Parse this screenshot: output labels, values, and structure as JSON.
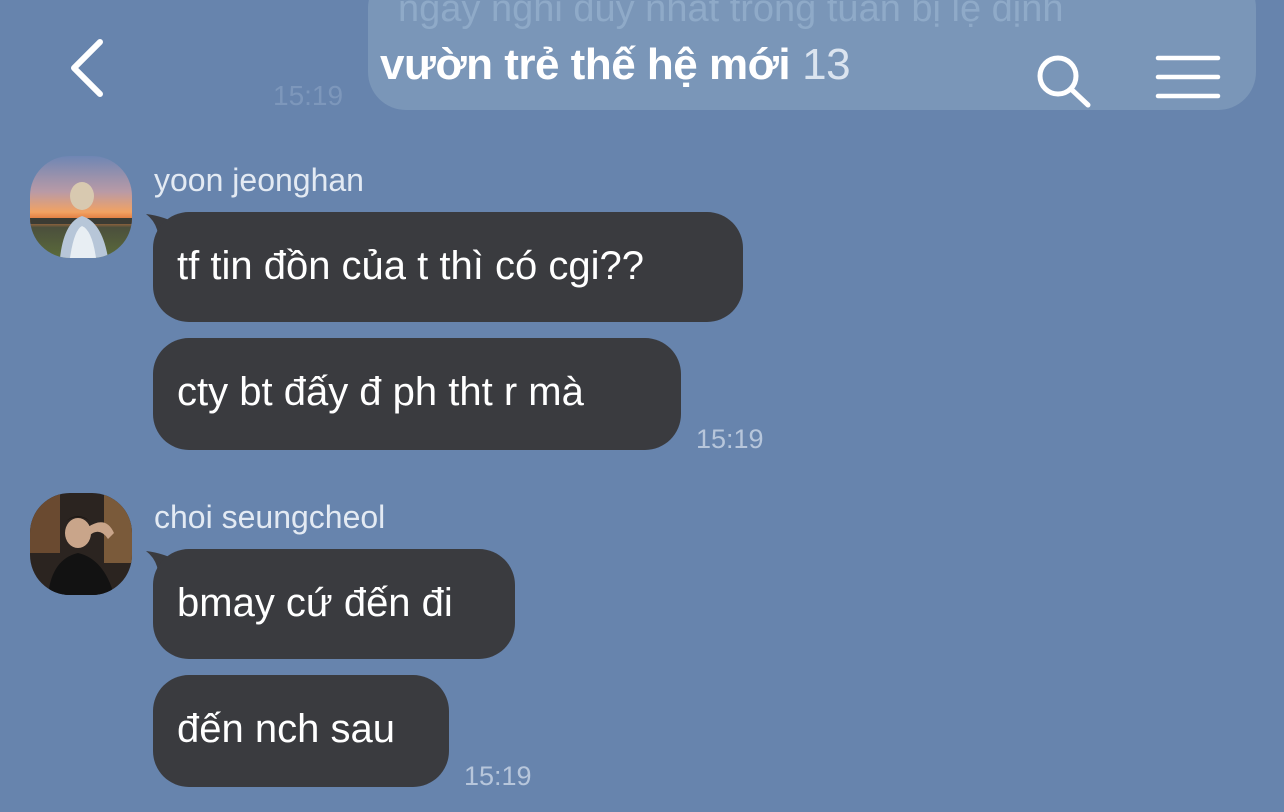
{
  "header": {
    "title": "vườn trẻ thế hệ mới",
    "member_count": "13"
  },
  "previous_message": {
    "text": "ngày nghỉ duy nhất trong tuần bị lệ định",
    "time": "15:19"
  },
  "groups": [
    {
      "sender": "yoon jeonghan",
      "messages": [
        "tf tin đồn của t thì có cgi??",
        "cty bt đấy đ ph tht r mà"
      ],
      "time": "15:19"
    },
    {
      "sender": "choi seungcheol",
      "messages": [
        "bmay cứ đến đi",
        "đến nch sau"
      ],
      "time": "15:19"
    }
  ],
  "colors": {
    "background": "#6784ad",
    "bubble": "#3a3b3f",
    "text": "#ffffff"
  },
  "icons": [
    "back-arrow-icon",
    "search-icon",
    "menu-icon"
  ]
}
